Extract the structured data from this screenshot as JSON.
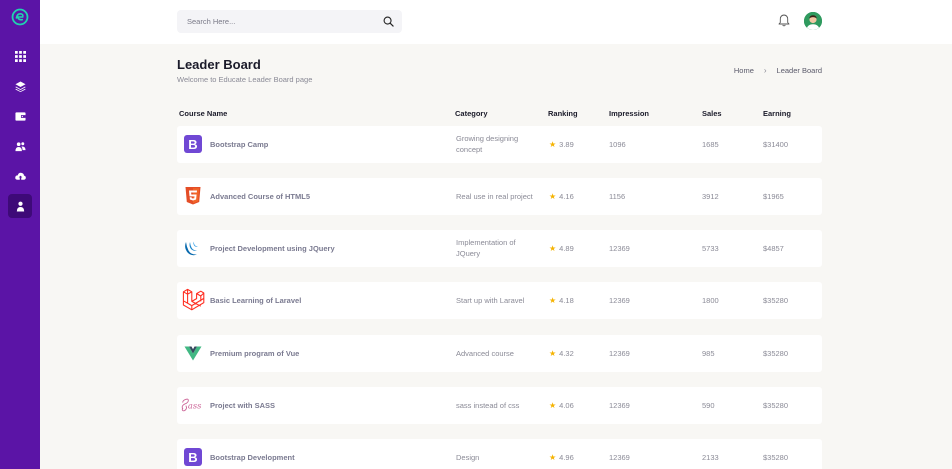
{
  "colors": {
    "sidebar": "#5b14a6",
    "accent_star": "#f5b301",
    "logo": "#1fd3b0"
  },
  "search": {
    "placeholder": "Search Here..."
  },
  "page": {
    "title": "Leader Board",
    "subtitle": "Welcome to Educate Leader Board page"
  },
  "breadcrumb": {
    "home": "Home",
    "current": "Leader Board"
  },
  "table": {
    "headers": {
      "course": "Course Name",
      "category": "Category",
      "ranking": "Ranking",
      "impression": "Impression",
      "sales": "Sales",
      "earning": "Earning"
    },
    "rows": [
      {
        "icon": "bootstrap-icon",
        "name": "Bootstrap Camp",
        "category": "Growing designing concept",
        "ranking": "3.89",
        "impression": "1096",
        "sales": "1685",
        "earning": "$31400"
      },
      {
        "icon": "html5-icon",
        "name": "Advanced Course of HTML5",
        "category": "Real use in real project",
        "ranking": "4.16",
        "impression": "1156",
        "sales": "3912",
        "earning": "$1965"
      },
      {
        "icon": "jquery-icon",
        "name": "Project Development using JQuery",
        "category": "Implementation of JQuery",
        "ranking": "4.89",
        "impression": "12369",
        "sales": "5733",
        "earning": "$4857"
      },
      {
        "icon": "laravel-icon",
        "name": "Basic Learning of Laravel",
        "category": "Start up with Laravel",
        "ranking": "4.18",
        "impression": "12369",
        "sales": "1800",
        "earning": "$35280"
      },
      {
        "icon": "vue-icon",
        "name": "Premium program of Vue",
        "category": "Advanced course",
        "ranking": "4.32",
        "impression": "12369",
        "sales": "985",
        "earning": "$35280"
      },
      {
        "icon": "sass-icon",
        "name": "Project with SASS",
        "category": "sass instead of css",
        "ranking": "4.06",
        "impression": "12369",
        "sales": "590",
        "earning": "$35280"
      },
      {
        "icon": "bootstrap-icon",
        "name": "Bootstrap Development",
        "category": "Design",
        "ranking": "4.96",
        "impression": "12369",
        "sales": "2133",
        "earning": "$35280"
      }
    ]
  }
}
